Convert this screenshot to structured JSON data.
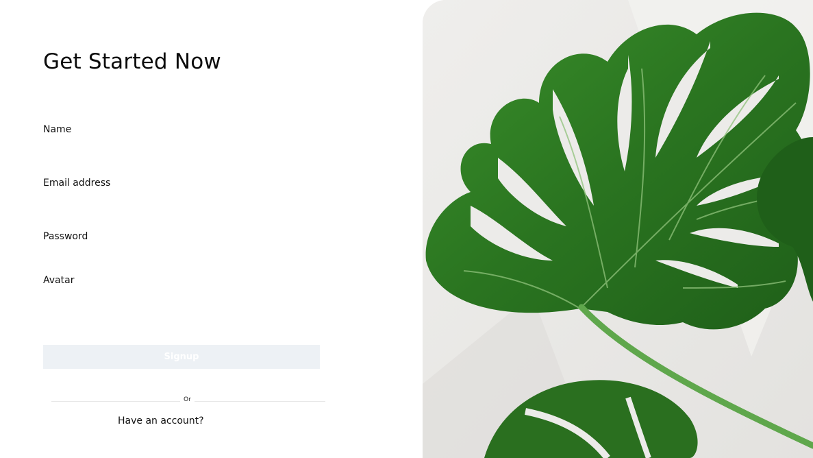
{
  "header": {
    "title": "Get Started Now"
  },
  "form": {
    "name_label": "Name",
    "email_label": "Email address",
    "password_label": "Password",
    "avatar_label": "Avatar",
    "signup_label": "Signup",
    "or_label": "Or",
    "have_account_label": "Have an account?"
  },
  "colors": {
    "signup_bg": "#edf1f5",
    "leaf_green": "#2f7d24",
    "photo_bg": "#ecebe9"
  },
  "image": {
    "subject": "monstera-leaf"
  }
}
